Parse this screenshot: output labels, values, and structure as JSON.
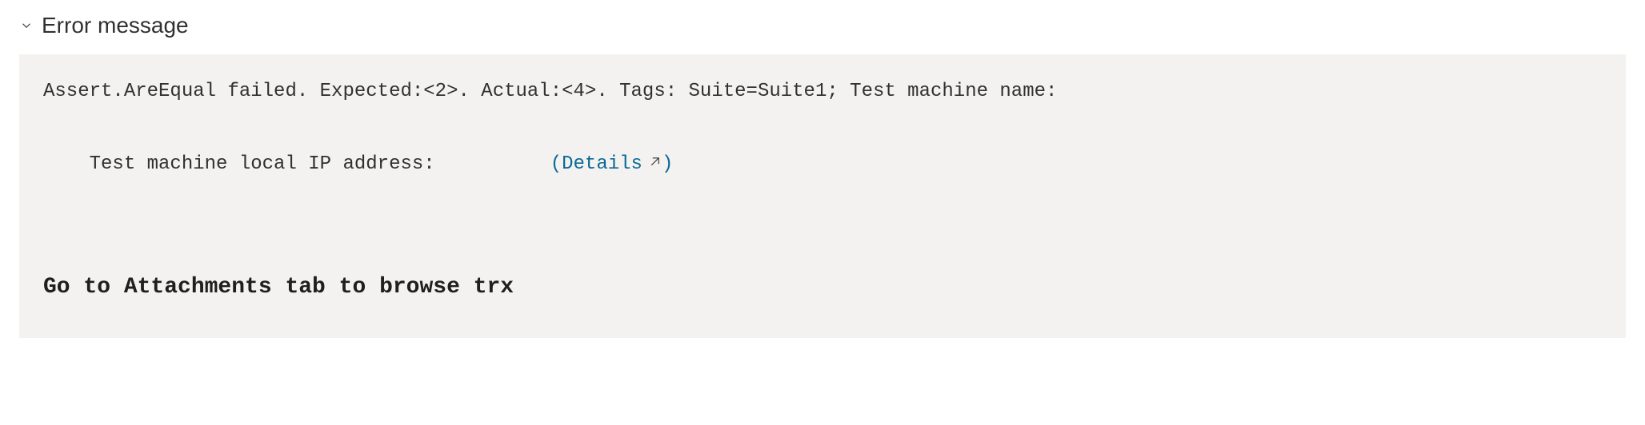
{
  "section": {
    "title": "Error message"
  },
  "error": {
    "line1": "Assert.AreEqual failed. Expected:<2>. Actual:<4>. Tags: Suite=Suite1; Test machine name:",
    "line2_prefix": "Test machine local IP address:          ",
    "details_open": "(",
    "details_label": "Details",
    "details_close": ")"
  },
  "hint": "Go to Attachments tab to browse trx"
}
